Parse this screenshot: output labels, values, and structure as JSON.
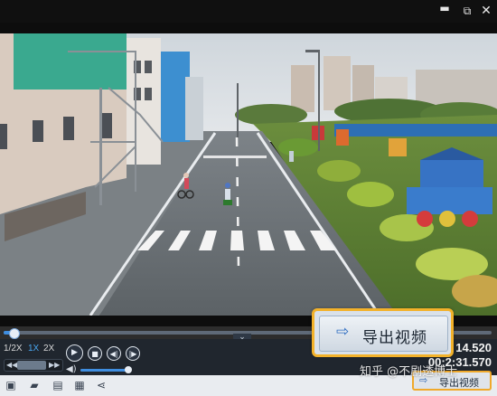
{
  "window": {
    "minimize_glyph": "▬",
    "maximize_glyph": "⧉",
    "close_glyph": "✕"
  },
  "player": {
    "progress_fraction": 0.02,
    "speed_options": [
      "1/2X",
      "1X",
      "2X"
    ],
    "active_speed": "1X",
    "mini_left_glyph": "◀◀",
    "mini_right_glyph": "▶▶",
    "play_glyph": "▶",
    "stop_glyph": "■",
    "prev_frame_glyph": "◀|",
    "next_frame_glyph": "|▶",
    "volume_glyph": "◀)",
    "volume_fraction": 0.95,
    "chevron_glyph": "⌄",
    "time_current": "14.520",
    "time_total": "00:2:31.570"
  },
  "toolbar": {
    "screenshot_glyph": "▣",
    "folder_glyph": "▰",
    "save_glyph": "▤",
    "info_glyph": "▦",
    "share_glyph": "⋖",
    "export_label": "导出视频",
    "export_icon": "⇨"
  },
  "callout": {
    "export_label": "导出视频",
    "export_icon": "⇨"
  },
  "watermark": "知乎 @不剧透博士",
  "colors": {
    "accent": "#3f8ee0",
    "highlight_border": "#f3b22a"
  }
}
